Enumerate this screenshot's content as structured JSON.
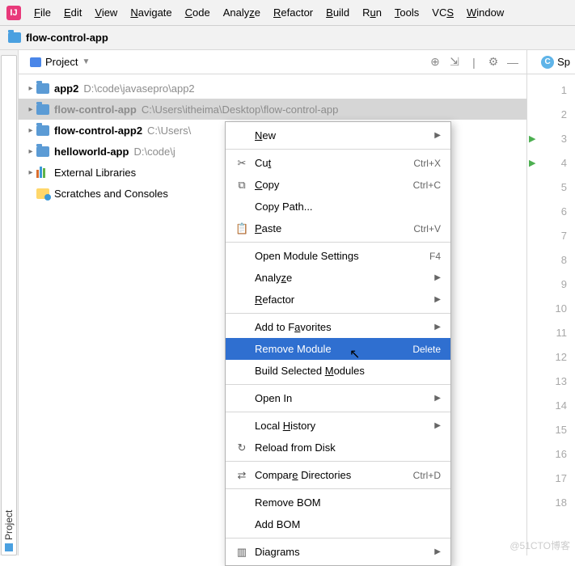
{
  "menubar": {
    "items": [
      {
        "pre": "",
        "u": "F",
        "post": "ile"
      },
      {
        "pre": "",
        "u": "E",
        "post": "dit"
      },
      {
        "pre": "",
        "u": "V",
        "post": "iew"
      },
      {
        "pre": "",
        "u": "N",
        "post": "avigate"
      },
      {
        "pre": "",
        "u": "C",
        "post": "ode"
      },
      {
        "pre": "Analy",
        "u": "z",
        "post": "e"
      },
      {
        "pre": "",
        "u": "R",
        "post": "efactor"
      },
      {
        "pre": "",
        "u": "B",
        "post": "uild"
      },
      {
        "pre": "R",
        "u": "u",
        "post": "n"
      },
      {
        "pre": "",
        "u": "T",
        "post": "ools"
      },
      {
        "pre": "VC",
        "u": "S",
        "post": ""
      },
      {
        "pre": "",
        "u": "W",
        "post": "indow"
      }
    ]
  },
  "breadcrumb": {
    "project": "flow-control-app"
  },
  "side_tab": {
    "label": "Project"
  },
  "panel": {
    "selector_label": "Project"
  },
  "right_tab": {
    "label": "Sp"
  },
  "tree": {
    "items": [
      {
        "name": "app2",
        "path": "D:\\code\\javasepro\\app2",
        "muted": false
      },
      {
        "name": "flow-control-app",
        "path": "C:\\Users\\itheima\\Desktop\\flow-control-app",
        "muted": true,
        "selected": true
      },
      {
        "name": "flow-control-app2",
        "path": "C:\\Users\\",
        "muted": false
      },
      {
        "name": "helloworld-app",
        "path": "D:\\code\\j",
        "muted": false
      }
    ],
    "libs_label": "External Libraries",
    "scratch_label": "Scratches and Consoles"
  },
  "gutter": {
    "lines": [
      "1",
      "2",
      "3",
      "4",
      "5",
      "6",
      "7",
      "8",
      "9",
      "10",
      "11",
      "12",
      "13",
      "14",
      "15",
      "16",
      "17",
      "18"
    ],
    "run_markers": [
      3,
      4
    ]
  },
  "context_menu": {
    "items": [
      {
        "type": "item",
        "icon": "",
        "label_pre": "",
        "u": "N",
        "label_post": "ew",
        "shortcut": "",
        "submenu": true
      },
      {
        "type": "sep"
      },
      {
        "type": "item",
        "icon": "✂",
        "label_pre": "Cu",
        "u": "t",
        "label_post": "",
        "shortcut": "Ctrl+X"
      },
      {
        "type": "item",
        "icon": "⧉",
        "label_pre": "",
        "u": "C",
        "label_post": "opy",
        "shortcut": "Ctrl+C"
      },
      {
        "type": "item",
        "icon": "",
        "label_pre": "Copy Path...",
        "u": "",
        "label_post": "",
        "shortcut": ""
      },
      {
        "type": "item",
        "icon": "📋",
        "label_pre": "",
        "u": "P",
        "label_post": "aste",
        "shortcut": "Ctrl+V"
      },
      {
        "type": "sep"
      },
      {
        "type": "item",
        "icon": "",
        "label_pre": "Open Module Settings",
        "u": "",
        "label_post": "",
        "shortcut": "F4"
      },
      {
        "type": "item",
        "icon": "",
        "label_pre": "Analy",
        "u": "z",
        "label_post": "e",
        "shortcut": "",
        "submenu": true
      },
      {
        "type": "item",
        "icon": "",
        "label_pre": "",
        "u": "R",
        "label_post": "efactor",
        "shortcut": "",
        "submenu": true
      },
      {
        "type": "sep"
      },
      {
        "type": "item",
        "icon": "",
        "label_pre": "Add to F",
        "u": "a",
        "label_post": "vorites",
        "shortcut": "",
        "submenu": true
      },
      {
        "type": "item",
        "icon": "",
        "label_pre": "Remove Module",
        "u": "",
        "label_post": "",
        "shortcut": "Delete",
        "highlight": true
      },
      {
        "type": "item",
        "icon": "",
        "label_pre": "Build Selected ",
        "u": "M",
        "label_post": "odules",
        "shortcut": ""
      },
      {
        "type": "sep"
      },
      {
        "type": "item",
        "icon": "",
        "label_pre": "Open In",
        "u": "",
        "label_post": "",
        "shortcut": "",
        "submenu": true
      },
      {
        "type": "sep"
      },
      {
        "type": "item",
        "icon": "",
        "label_pre": "Local ",
        "u": "H",
        "label_post": "istory",
        "shortcut": "",
        "submenu": true
      },
      {
        "type": "item",
        "icon": "↻",
        "label_pre": "Reload from Disk",
        "u": "",
        "label_post": "",
        "shortcut": ""
      },
      {
        "type": "sep"
      },
      {
        "type": "item",
        "icon": "⇄",
        "label_pre": "Compar",
        "u": "e",
        "label_post": " Directories",
        "shortcut": "Ctrl+D"
      },
      {
        "type": "sep"
      },
      {
        "type": "item",
        "icon": "",
        "label_pre": "Remove BOM",
        "u": "",
        "label_post": "",
        "shortcut": ""
      },
      {
        "type": "item",
        "icon": "",
        "label_pre": "Add BOM",
        "u": "",
        "label_post": "",
        "shortcut": ""
      },
      {
        "type": "sep"
      },
      {
        "type": "item",
        "icon": "▥",
        "label_pre": "Diagrams",
        "u": "",
        "label_post": "",
        "shortcut": "",
        "submenu": true
      }
    ]
  },
  "watermark": "@51CTO博客"
}
